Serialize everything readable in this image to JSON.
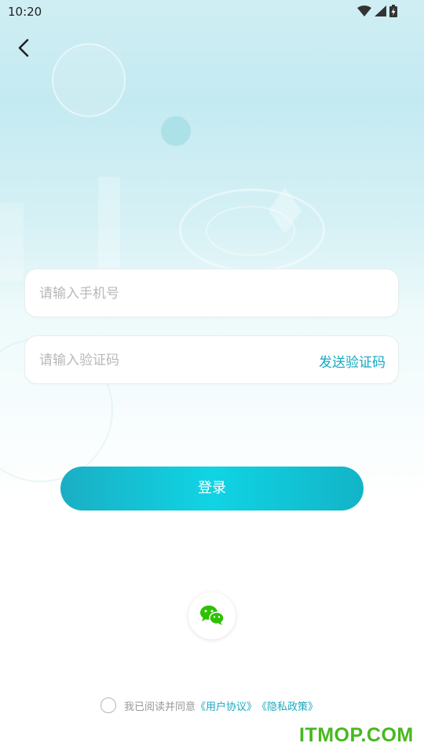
{
  "status_bar": {
    "time": "10:20",
    "icons": [
      "wifi-icon",
      "signal-icon",
      "battery-charging-icon"
    ]
  },
  "nav": {
    "back_icon": "chevron-left-icon"
  },
  "form": {
    "phone_placeholder": "请输入手机号",
    "phone_value": "",
    "code_placeholder": "请输入验证码",
    "code_value": "",
    "send_code_label": "发送验证码"
  },
  "login_button_label": "登录",
  "third_party": {
    "wechat_icon": "wechat-icon"
  },
  "agreement": {
    "checked": false,
    "prefix": "我已阅读并同意",
    "user_agreement": "《用户协议》",
    "privacy_policy": "《隐私政策》"
  },
  "watermark": "ITMOP.COM",
  "colors": {
    "accent": "#13a9c3",
    "button_gradient": [
      "#1aaec3",
      "#10d4e4",
      "#12b4c7"
    ],
    "wechat_green": "#2dc100",
    "watermark_green": "#47b81e"
  }
}
